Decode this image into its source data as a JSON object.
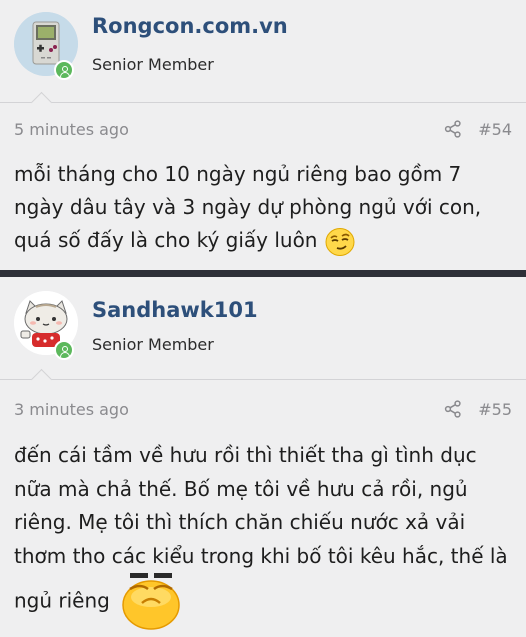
{
  "posts": [
    {
      "username": "Rongcon.com.vn",
      "role": "Senior Member",
      "time": "5 minutes ago",
      "number": "#54",
      "content": "mỗi tháng cho 10 ngày ngủ riêng bao gồm 7 ngày dâu tây và 3 ngày dự phòng ngủ với con, quá số đấy là cho ký giấy luôn",
      "avatar_icon": "gameboy-icon",
      "emoji_icon": "smirk-emoji-icon"
    },
    {
      "username": "Sandhawk101",
      "role": "Senior Member",
      "time": "3 minutes ago",
      "number": "#55",
      "content": "đến cái tầm về hưu rồi thì thiết tha gì tình dục nữa mà chả thế. Bố mẹ tôi về hưu cả rồi, ngủ riêng. Mẹ tôi thì thích chăn chiếu nước xả vải thơm tho các kiểu trong khi bố tôi kêu hắc, thế là ngủ riêng",
      "avatar_icon": "cat-avatar-icon",
      "emoji_icon": "annoyed-emoji-icon"
    }
  ],
  "colors": {
    "username": "#2d4f7a",
    "online_badge": "#5cb85c",
    "divider": "#2e3038",
    "background": "#efeff0"
  }
}
